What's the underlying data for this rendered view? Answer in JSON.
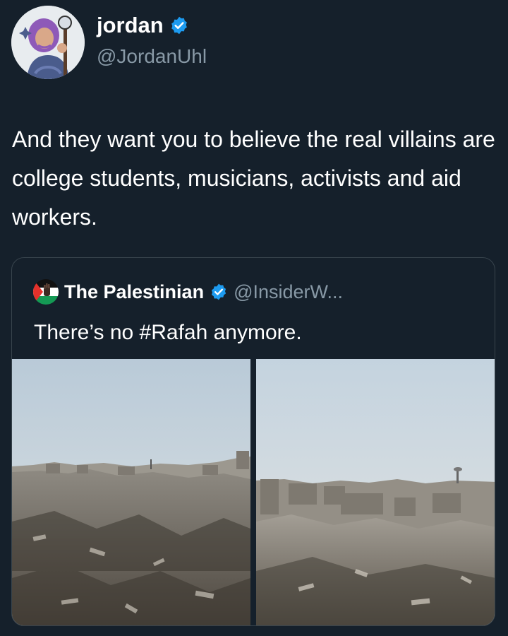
{
  "tweet": {
    "author_name": "jordan",
    "author_handle": "@JordanUhl",
    "verified": true,
    "text": "And they want you to believe the real villains are college students, musicians, activists and aid workers."
  },
  "quoted_tweet": {
    "author_name": "The Palestinian",
    "author_handle": "@InsiderW...",
    "verified": true,
    "text": "There’s no #Rafah anymore.",
    "media": [
      {
        "icon": "photo-rubble-wide"
      },
      {
        "icon": "photo-rubble-water-tower"
      }
    ]
  },
  "colors": {
    "background": "#15202b",
    "secondary_text": "#8899a6",
    "verified_blue": "#1d9bf0",
    "border": "#38444d"
  }
}
